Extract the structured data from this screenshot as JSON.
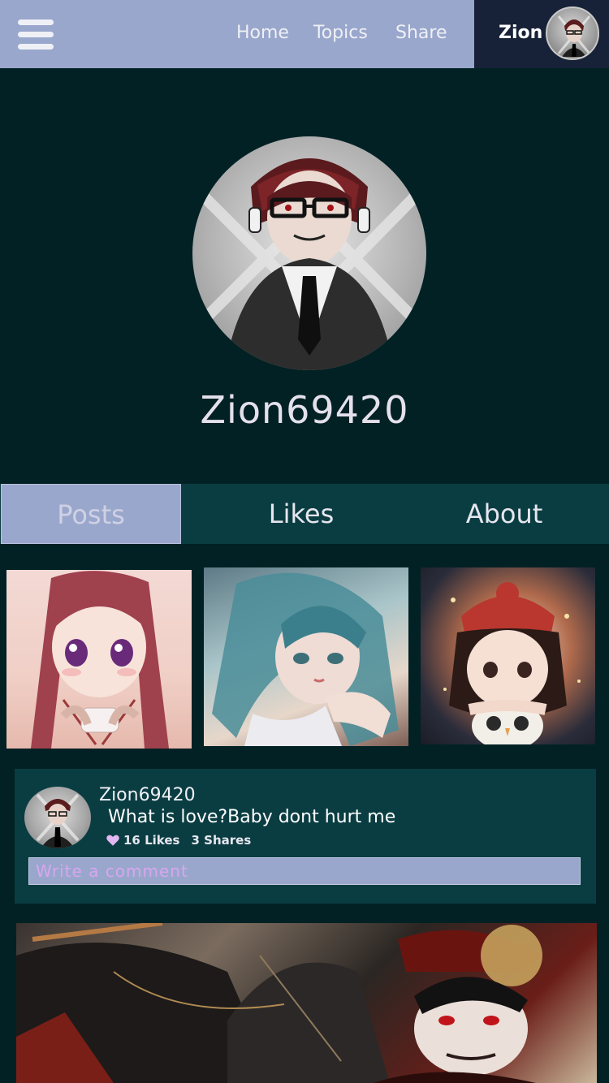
{
  "topbar": {
    "menu_icon": "hamburger-icon",
    "nav": [
      {
        "label": "Home"
      },
      {
        "label": "Topics"
      },
      {
        "label": "Share"
      }
    ],
    "user": {
      "name": "Zion",
      "avatar": "avatar-icon"
    }
  },
  "profile": {
    "username": "Zion69420",
    "avatar": "profile-avatar"
  },
  "tabs": [
    {
      "label": "Posts",
      "active": true
    },
    {
      "label": "Likes",
      "active": false
    },
    {
      "label": "About",
      "active": false
    }
  ],
  "gallery": [
    "anime-girl-thumbnail",
    "elf-girl-thumbnail",
    "girl-with-owl-thumbnail"
  ],
  "post": {
    "author": "Zion69420",
    "text": "What is love?Baby dont hurt me",
    "likes": "16 Likes",
    "shares": "3 Shares",
    "heart_icon": "heart-icon",
    "comment_placeholder": "Write a comment"
  },
  "colors": {
    "background": "#022124",
    "topbar": "#9aa7cc",
    "user_box": "#172238",
    "card": "#0a3d42",
    "heart": "#e3b8f2"
  }
}
